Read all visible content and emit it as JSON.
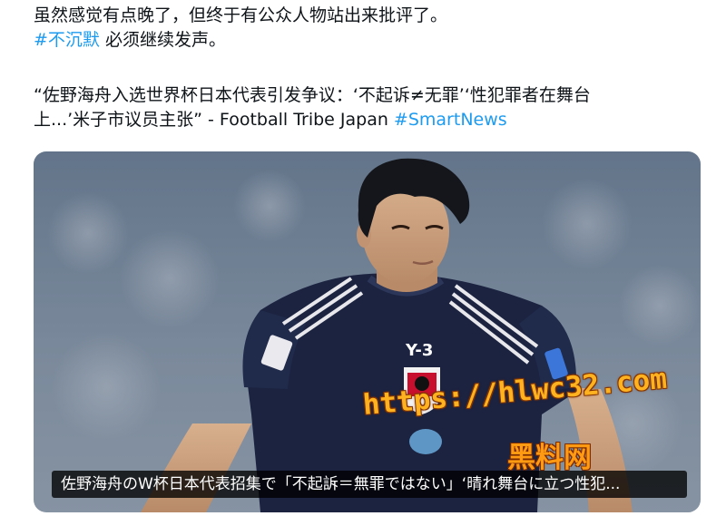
{
  "post": {
    "line1": "虽然感觉有点晚了，但终于有公众人物站出来批评了。",
    "hashtag1": "#不沉默",
    "line2_rest": " 必须继续发声。",
    "quote_line1": "“佐野海舟入选世界杯日本代表引发争议：‘不起诉≠无罪’‘性犯罪者在舞台",
    "quote_line2": "上...’米子市议员主张” - Football Tribe Japan ",
    "hashtag2": "#SmartNews"
  },
  "media": {
    "jersey_text": "Y-3",
    "caption": "佐野海舟のW杯日本代表招集で「不起訴＝無罪ではない」‘晴れ舞台に立つ性犯...",
    "watermark_url": "https://hlwc32.com",
    "watermark_name": "黑料网"
  },
  "colors": {
    "hashtag": "#1d9bf0",
    "jersey": "#1b2340",
    "watermark": "#ffb21f"
  }
}
